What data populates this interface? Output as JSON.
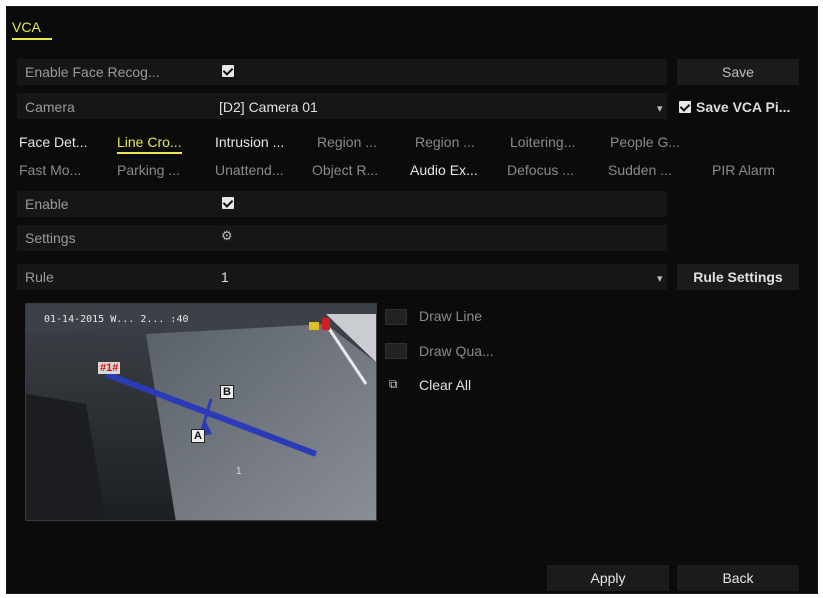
{
  "window": {
    "tab_title": "VCA"
  },
  "toolbar": {
    "save_label": "Save"
  },
  "form": {
    "enable_face_label": "Enable Face Recog...",
    "camera_label": "Camera",
    "camera_value": "[D2] Camera 01",
    "save_vca_label": "Save VCA Pi...",
    "enable_label": "Enable",
    "settings_label": "Settings",
    "rule_label": "Rule",
    "rule_value": "1",
    "rule_settings_label": "Rule Settings"
  },
  "detection_tabs": {
    "row1": [
      "Face Det...",
      "Line Cro...",
      "Intrusion ...",
      "Region ...",
      "Region ...",
      "Loitering...",
      "People G..."
    ],
    "row2": [
      "Fast Mo...",
      "Parking ...",
      "Unattend...",
      "Object R...",
      "Audio Ex...",
      "Defocus ...",
      "Sudden ...",
      "PIR Alarm"
    ],
    "active": "Line Cro..."
  },
  "preview": {
    "timestamp": "01-14-2015 W... 2... :40",
    "rule_tag": "#1#",
    "point_a": "A",
    "point_b": "B",
    "center_text": "1"
  },
  "draw_tools": {
    "draw_line": "Draw Line",
    "draw_quad": "Draw Qua...",
    "clear_all": "Clear All"
  },
  "footer": {
    "apply_label": "Apply",
    "back_label": "Back"
  },
  "colors": {
    "accent": "#e9e94f",
    "rule_line": "#2a3ab8",
    "background": "#0b0b0b"
  },
  "icons": {
    "checkbox": "checkbox-checked-icon",
    "settings": "gear-icon",
    "dropdown": "chevron-down-icon",
    "clear": "clear-icon"
  }
}
